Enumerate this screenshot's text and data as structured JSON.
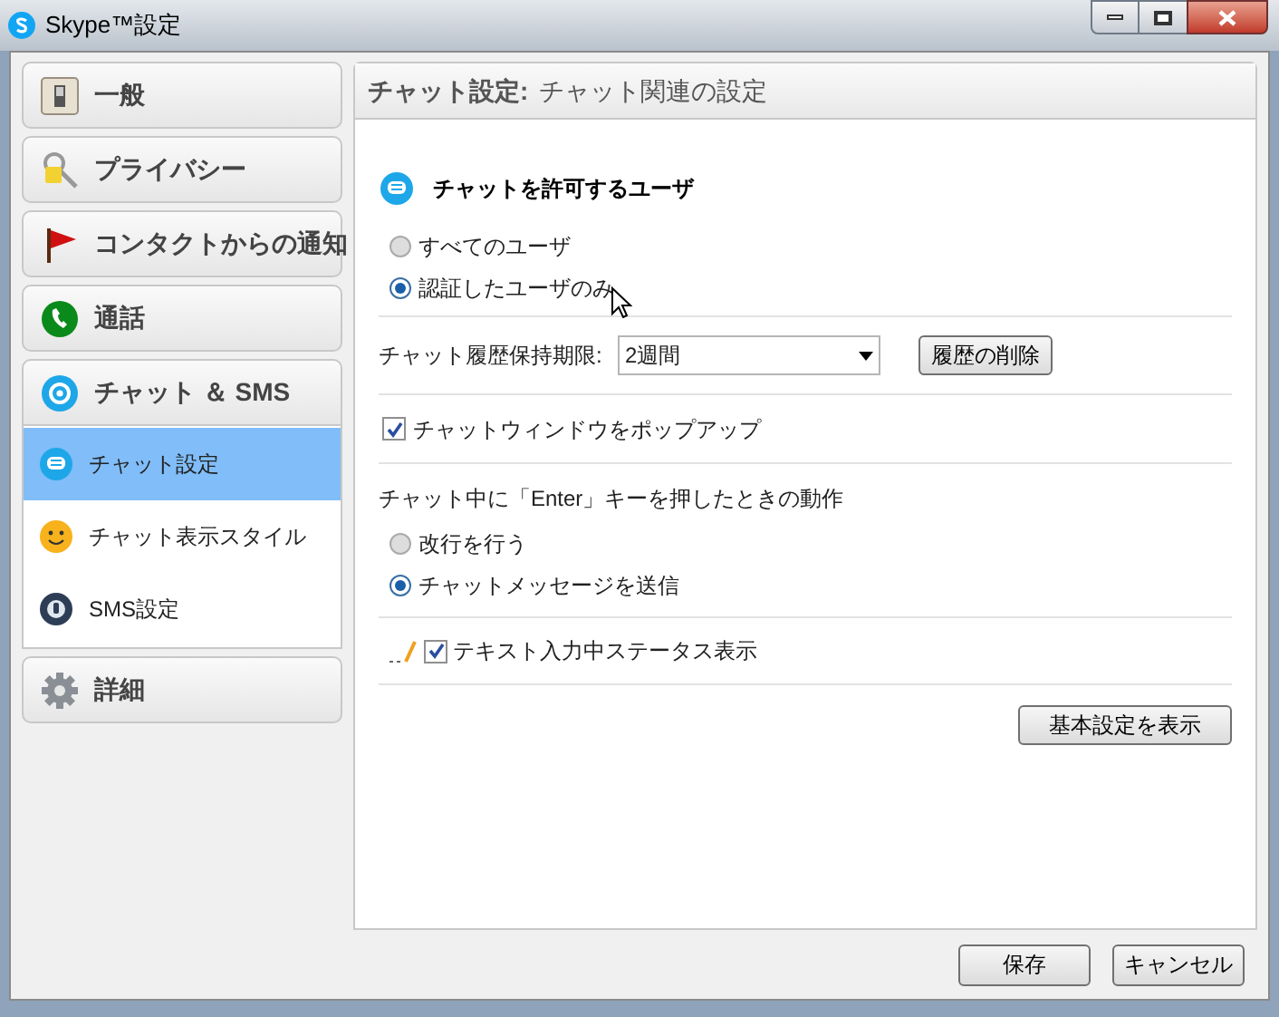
{
  "window": {
    "title": "Skype™設定"
  },
  "sidebar": {
    "categories": [
      {
        "label": "一般",
        "selected": false
      },
      {
        "label": "プライバシー",
        "selected": false
      },
      {
        "label": "コンタクトからの通知",
        "selected": false
      },
      {
        "label": "通話",
        "selected": false
      },
      {
        "label": "チャット ＆ SMS",
        "selected": true,
        "children": [
          {
            "label": "チャット設定",
            "selected": true
          },
          {
            "label": "チャット表示スタイル",
            "selected": false
          },
          {
            "label": "SMS設定",
            "selected": false
          }
        ]
      },
      {
        "label": "詳細",
        "selected": false
      }
    ]
  },
  "panel": {
    "title": "チャット設定:",
    "subtitle": "チャット関連の設定",
    "allow": {
      "heading": "チャットを許可するユーザ",
      "options": [
        {
          "label": "すべてのユーザ",
          "selected": false
        },
        {
          "label": "認証したユーザのみ",
          "selected": true
        }
      ]
    },
    "history": {
      "label": "チャット履歴保持期限:",
      "value": "2週間",
      "button": "履歴の削除"
    },
    "popup": {
      "label": "チャットウィンドウをポップアップ",
      "checked": true
    },
    "enter": {
      "label": "チャット中に「Enter」キーを押したときの動作",
      "options": [
        {
          "label": "改行を行う",
          "selected": false
        },
        {
          "label": "チャットメッセージを送信",
          "selected": true
        }
      ]
    },
    "typing": {
      "label": "テキスト入力中ステータス表示",
      "checked": true
    },
    "basic_button": "基本設定を表示"
  },
  "footer": {
    "buttons": [
      "保存",
      "キャンセル"
    ]
  }
}
